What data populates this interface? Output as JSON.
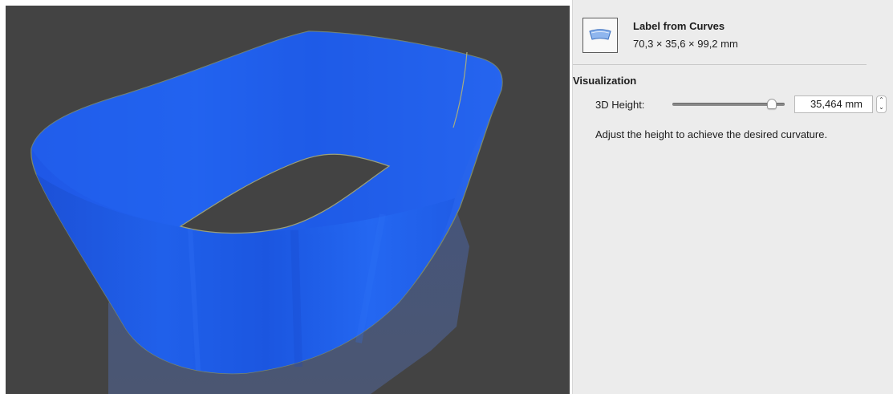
{
  "inspector": {
    "object": {
      "icon": "label-curve-icon",
      "title": "Label from Curves",
      "dimensions": "70,3 × 35,6 × 99,2 mm"
    },
    "section": {
      "title": "Visualization"
    },
    "height_control": {
      "label": "3D Height:",
      "value": "35,464 mm",
      "slider_fraction": 0.92
    },
    "help_text": "Adjust the height to achieve the desired curvature."
  },
  "viewport": {
    "background": "#434343",
    "object_color": "#1f5bea",
    "shadow_color": "#4a5877"
  }
}
